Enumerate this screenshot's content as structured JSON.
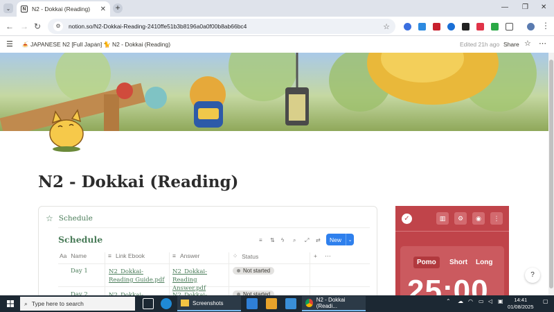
{
  "browser": {
    "tab_title": "N2 - Dokkai (Reading)",
    "url": "notion.so/N2-Dokkai-Reading-2410ffe51b3b8196a0a0f00b8ab66bc4"
  },
  "notion": {
    "breadcrumb_parent": "JAPANESE N2 [Full Japan]",
    "breadcrumb_current": "N2 - Dokkai (Reading)",
    "edited": "Edited 21h ago",
    "share": "Share",
    "page_title": "N2 - Dokkai (Reading)"
  },
  "schedule": {
    "block_title": "Schedule",
    "db_title": "Schedule",
    "new_label": "New",
    "columns": [
      "Name",
      "Link Ebook",
      "Answer",
      "Status"
    ],
    "rows": [
      {
        "name": "Day 1",
        "ebook": "N2_Dokkai- Reading Guide.pdf",
        "answer": "N2_Dokkai- Reading Answer.pdf",
        "status": "Not started"
      },
      {
        "name": "Day 2",
        "ebook": "N2_Dokkai- Reading",
        "answer": "N2_Dokkai- Reading",
        "status": "Not started"
      }
    ]
  },
  "pomo": {
    "modes": [
      "Pomo",
      "Short",
      "Long"
    ],
    "timer": "25:00"
  },
  "taskbar": {
    "search_placeholder": "Type here to search",
    "screenshots_label": "Screenshots",
    "chrome_label": "N2 - Dokkai (Readi...",
    "time": "14:41",
    "date": "01/08/2025"
  },
  "colors": {
    "accent_green": "#4a7c59",
    "button_blue": "#2f80ed",
    "pomo_red": "#c0444a"
  }
}
